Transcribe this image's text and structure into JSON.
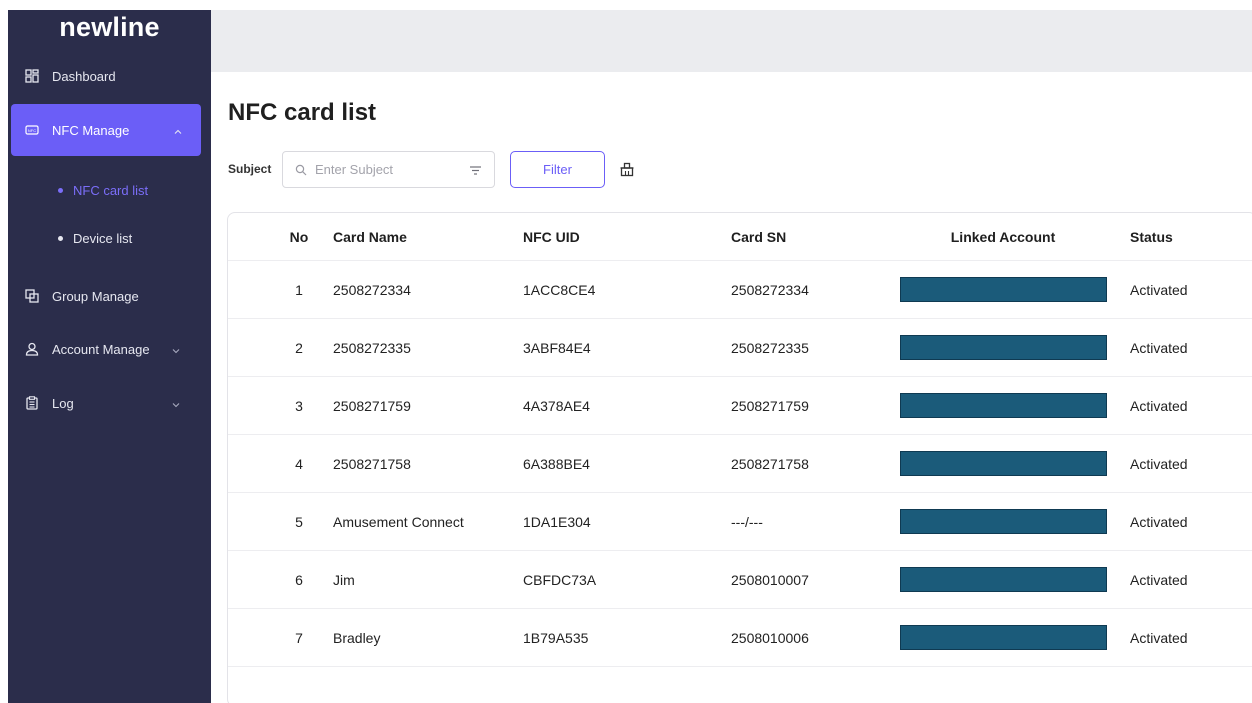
{
  "sidebar": {
    "brand": "newline",
    "items": [
      {
        "label": "Dashboard",
        "icon": "dashboard-icon"
      },
      {
        "label": "NFC Manage",
        "icon": "nfc-icon",
        "expanded": true
      },
      {
        "label": "Group Manage",
        "icon": "group-icon"
      },
      {
        "label": "Account Manage",
        "icon": "user-icon"
      },
      {
        "label": "Log",
        "icon": "clipboard-icon"
      }
    ],
    "subitems": [
      {
        "label": "NFC card list",
        "active": true
      },
      {
        "label": "Device list",
        "active": false
      }
    ]
  },
  "main": {
    "title": "NFC card list",
    "filter": {
      "label": "Subject",
      "placeholder": "Enter Subject",
      "button": "Filter"
    },
    "table": {
      "columns": [
        "No",
        "Card Name",
        "NFC UID",
        "Card SN",
        "Linked Account",
        "Status"
      ],
      "rows": [
        {
          "no": "1",
          "name": "2508272334",
          "uid": "1ACC8CE4",
          "sn": "2508272334",
          "status": "Activated"
        },
        {
          "no": "2",
          "name": "2508272335",
          "uid": "3ABF84E4",
          "sn": "2508272335",
          "status": "Activated"
        },
        {
          "no": "3",
          "name": "2508271759",
          "uid": "4A378AE4",
          "sn": "2508271759",
          "status": "Activated"
        },
        {
          "no": "4",
          "name": "2508271758",
          "uid": "6A388BE4",
          "sn": "2508271758",
          "status": "Activated"
        },
        {
          "no": "5",
          "name": "Amusement Connect",
          "uid": "1DA1E304",
          "sn": "---/---",
          "status": "Activated"
        },
        {
          "no": "6",
          "name": "Jim",
          "uid": "CBFDC73A",
          "sn": "2508010007",
          "status": "Activated"
        },
        {
          "no": "7",
          "name": "Bradley",
          "uid": "1B79A535",
          "sn": "2508010006",
          "status": "Activated"
        }
      ]
    }
  },
  "colors": {
    "sidebar_bg": "#2b2d4b",
    "accent": "#6b5ef7",
    "redaction": "#1b5b7a",
    "topbar_bg": "#ebecef"
  }
}
